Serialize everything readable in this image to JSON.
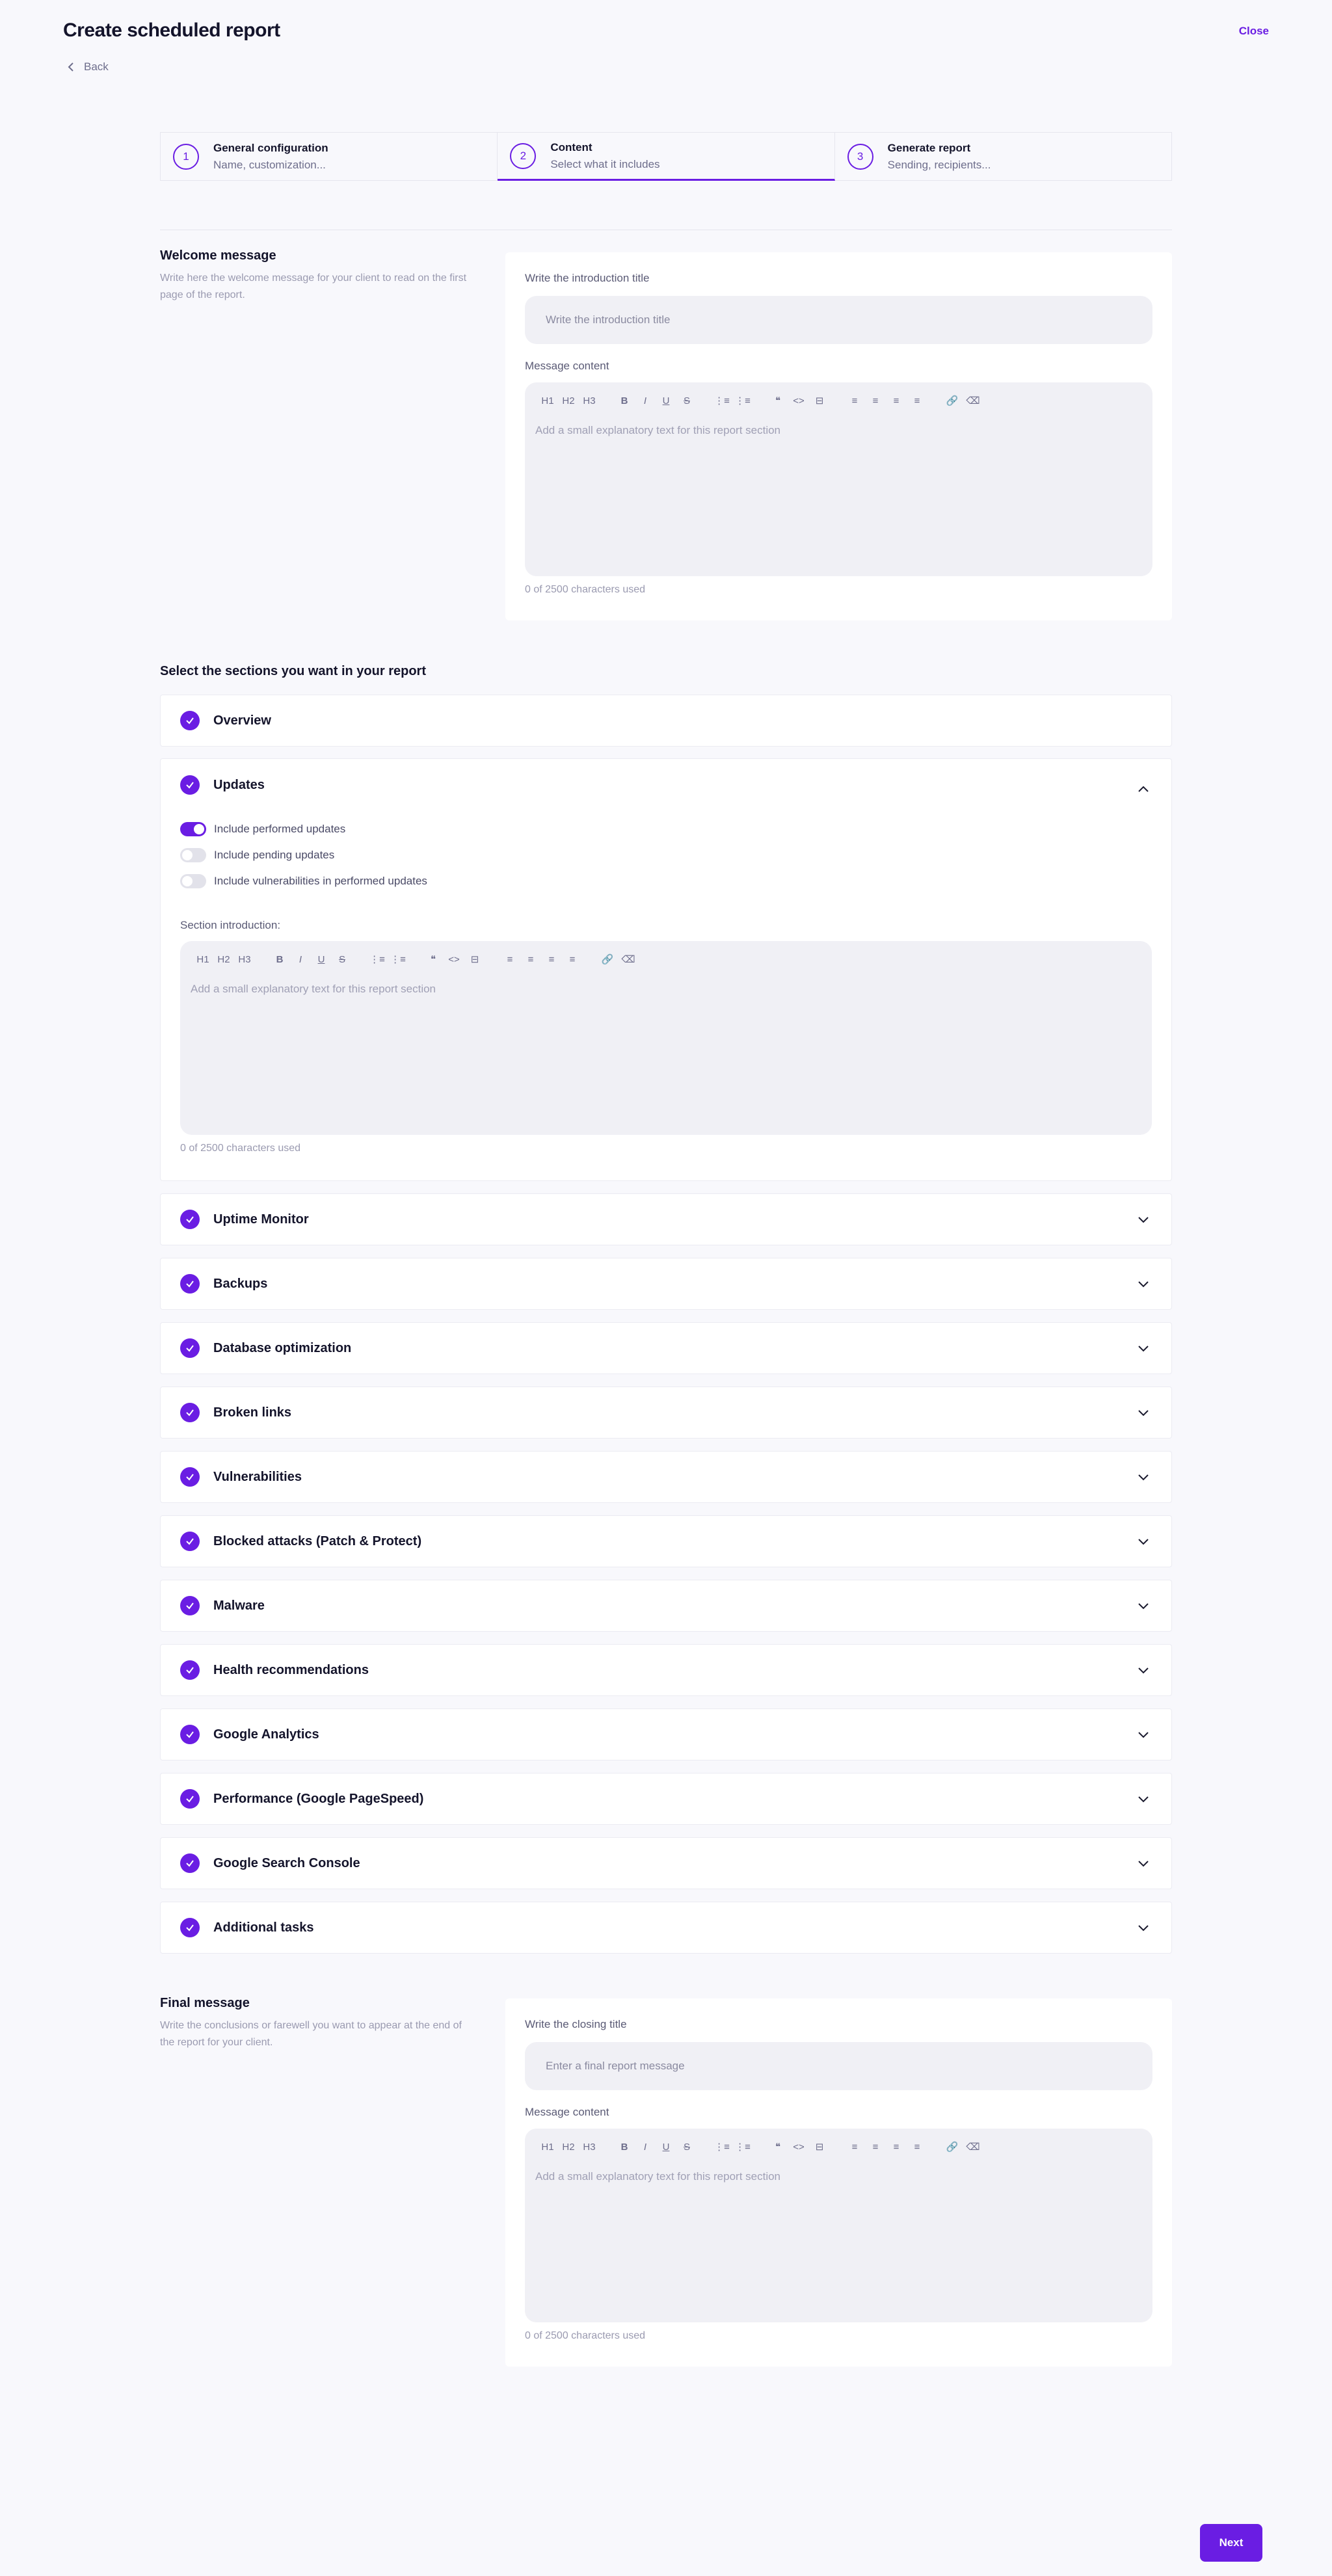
{
  "header": {
    "title": "Create scheduled report",
    "close_label": "Close",
    "back_label": "Back"
  },
  "stepper": [
    {
      "num": "1",
      "title": "General configuration",
      "sub": "Name, customization..."
    },
    {
      "num": "2",
      "title": "Content",
      "sub": "Select what it includes"
    },
    {
      "num": "3",
      "title": "Generate report",
      "sub": "Sending, recipients..."
    }
  ],
  "toolbar": {
    "h1": "H1",
    "h2": "H2",
    "h3": "H3",
    "bold": "B",
    "italic": "I",
    "underline": "U",
    "strike": "S",
    "ol": "⋮≡",
    "ul": "⋮≡",
    "quote": "❝",
    "code": "<>",
    "block": "⊟",
    "al": "≡",
    "ac": "≡",
    "ar": "≡",
    "aj": "≡",
    "link": "🔗",
    "clear": "⌫"
  },
  "welcome": {
    "heading": "Welcome message",
    "description": "Write here the welcome message for your client to read on the first page of the report.",
    "title_label": "Write the introduction title",
    "title_placeholder": "Write the introduction title",
    "content_label": "Message content",
    "content_placeholder": "Add a small explanatory text for this report section",
    "char_count": "0 of 2500 characters used"
  },
  "sections": {
    "title": "Select the sections you want in your report",
    "overview": "Overview",
    "updates": {
      "label": "Updates",
      "toggles": [
        {
          "label": "Include performed updates",
          "on": true
        },
        {
          "label": "Include pending updates",
          "on": false
        },
        {
          "label": "Include vulnerabilities in performed updates",
          "on": false
        }
      ],
      "intro_label": "Section introduction:",
      "intro_placeholder": "Add a small explanatory text for this report section",
      "char_count": "0 of 2500 characters used"
    },
    "items": [
      "Uptime Monitor",
      "Backups",
      "Database optimization",
      "Broken links",
      "Vulnerabilities",
      "Blocked attacks (Patch & Protect)",
      "Malware",
      "Health recommendations",
      "Google Analytics",
      "Performance (Google PageSpeed)",
      "Google Search Console",
      "Additional tasks"
    ]
  },
  "final": {
    "heading": "Final message",
    "description": "Write the conclusions or farewell you want to appear at the end of the report for your client.",
    "title_label": "Write the closing title",
    "title_placeholder": "Enter a final report message",
    "content_label": "Message content",
    "content_placeholder": "Add a small explanatory text for this report section",
    "char_count": "0 of 2500 characters used"
  },
  "footer": {
    "next_label": "Next"
  },
  "colors": {
    "accent": "#6a1de3",
    "background": "#f8f8fc"
  }
}
